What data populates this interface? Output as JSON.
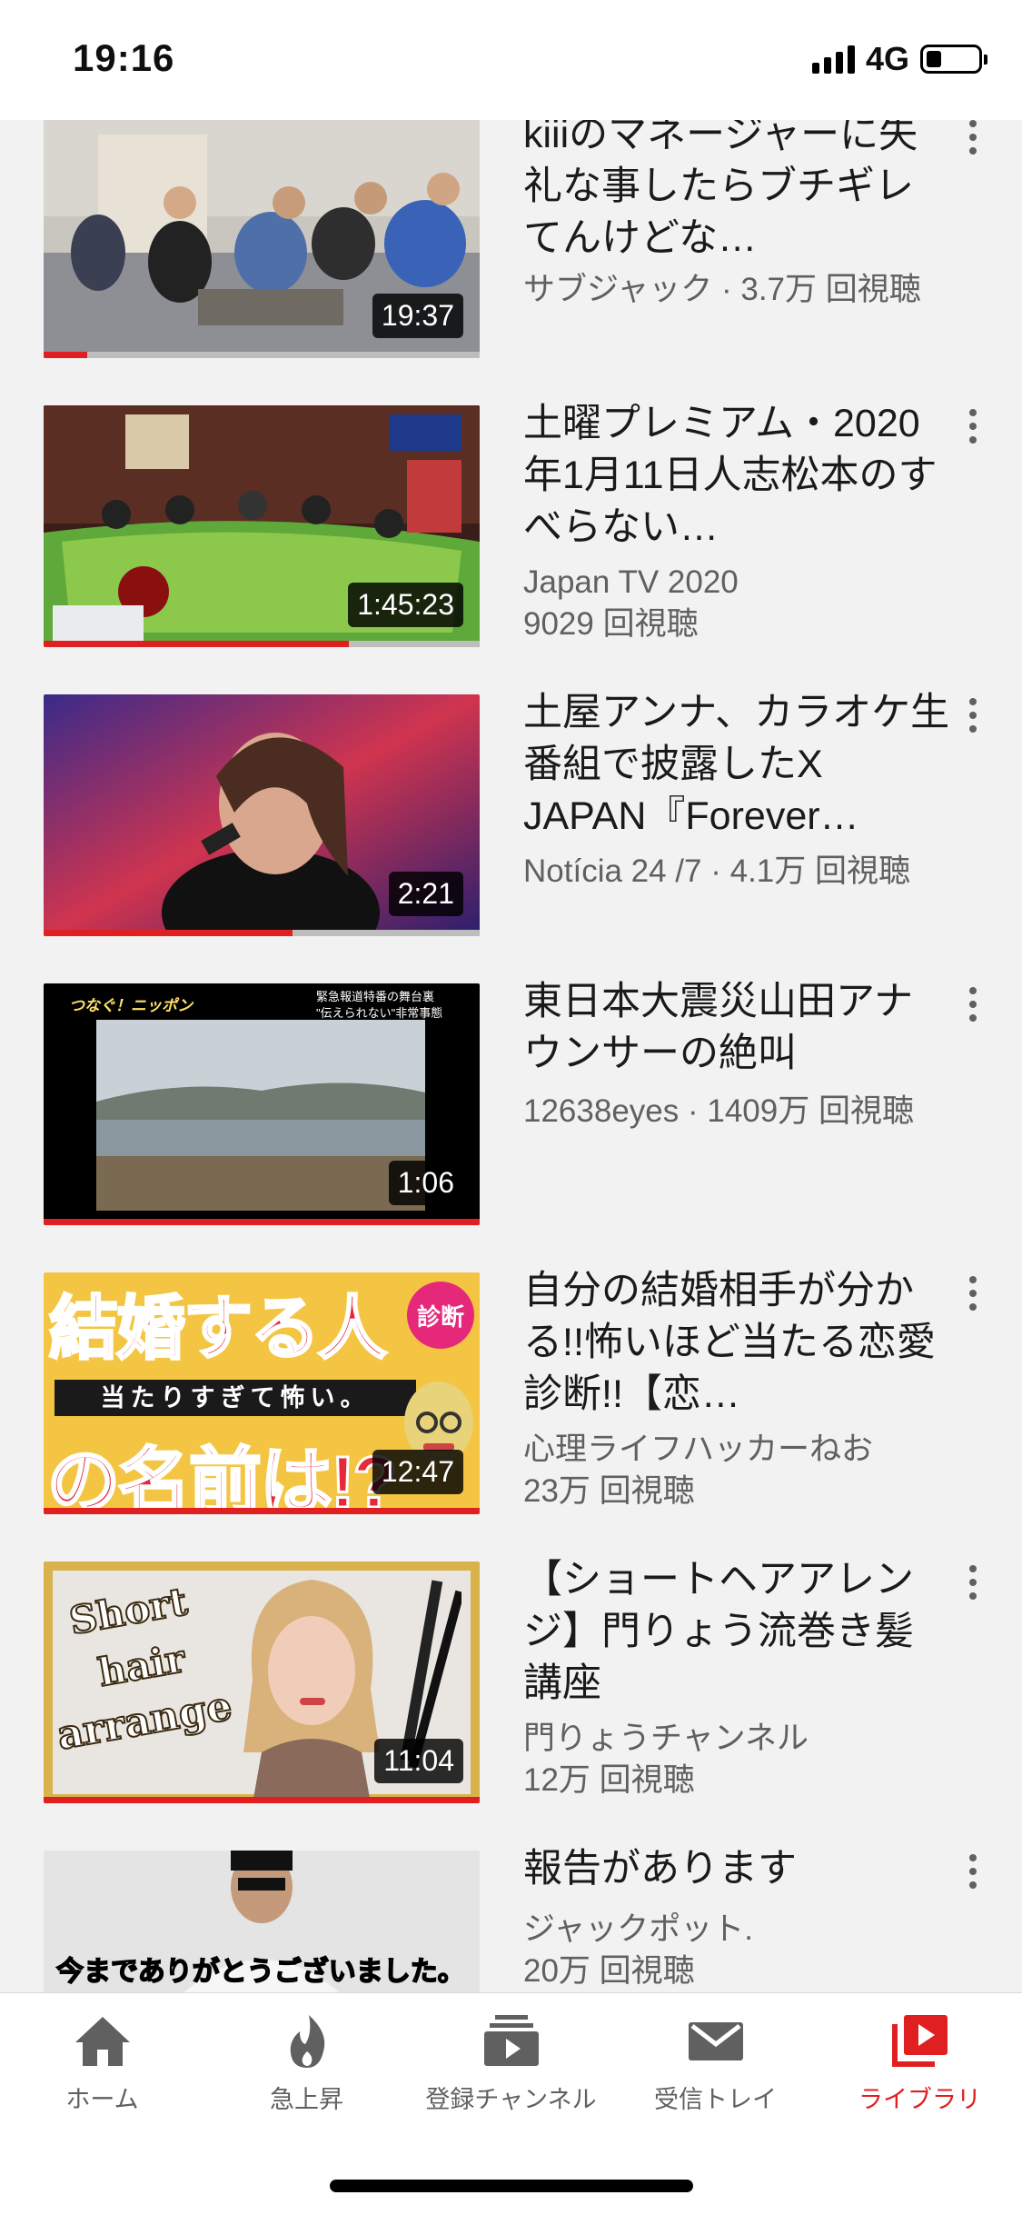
{
  "status": {
    "time": "19:16",
    "network": "4G",
    "battery_fraction": 0.3
  },
  "videos": [
    {
      "title": "kiiiのマネージャーに失礼な事したらブチギレてんけどな…",
      "meta1": "サブジャック · 3.7万 回視聴",
      "meta2": "",
      "duration": "19:37",
      "progress": 0.1
    },
    {
      "title": "土曜プレミアム・2020年1月11日人志松本のすべらない…",
      "meta1": "Japan TV 2020",
      "meta2": "9029 回視聴",
      "duration": "1:45:23",
      "progress": 0.7
    },
    {
      "title": "土屋アンナ、カラオケ生番組で披露したX JAPAN『Forever…",
      "meta1": "Notícia 24 /7 · 4.1万 回視聴",
      "meta2": "",
      "duration": "2:21",
      "progress": 0.57
    },
    {
      "title": "東日本大震災山田アナウンサーの絶叫",
      "meta1": "12638eyes · 1409万 回視聴",
      "meta2": "",
      "duration": "1:06",
      "progress": 1.0
    },
    {
      "title": "自分の結婚相手が分かる!!怖いほど当たる恋愛診断!!【恋…",
      "meta1": "心理ライフハッカーねお",
      "meta2": "23万 回視聴",
      "duration": "12:47",
      "progress": 1.0
    },
    {
      "title": "【ショートヘアアレンジ】門りょう流巻き髪講座",
      "meta1": "門りょうチャンネル",
      "meta2": "12万 回視聴",
      "duration": "11:04",
      "progress": 1.0
    },
    {
      "title": "報告があります",
      "meta1": "ジャックポット.",
      "meta2": "20万 回視聴",
      "duration": "",
      "progress": 0
    }
  ],
  "thumb_text": {
    "v5_main": "結婚する人",
    "v5_tag": "診断",
    "v5_sub": "当たりすぎて怖い。",
    "v5_bottom": "の名前は!?",
    "v6_l1": "Short",
    "v6_l2": "hair",
    "v6_l3": "arrange",
    "v7_caption": "今までありがとうございました。",
    "v4_corner": "緊急報道特番の舞台裏",
    "v4_corner2": "\"伝えられない\"非常事態"
  },
  "nav": [
    {
      "label": "ホーム",
      "icon": "home-icon",
      "active": false
    },
    {
      "label": "急上昇",
      "icon": "trending-icon",
      "active": false
    },
    {
      "label": "登録チャンネル",
      "icon": "subscriptions-icon",
      "active": false
    },
    {
      "label": "受信トレイ",
      "icon": "inbox-icon",
      "active": false
    },
    {
      "label": "ライブラリ",
      "icon": "library-icon",
      "active": true
    }
  ],
  "colors": {
    "accent": "#e02020",
    "background": "#f2f2f2",
    "secondary_text": "#606060"
  }
}
